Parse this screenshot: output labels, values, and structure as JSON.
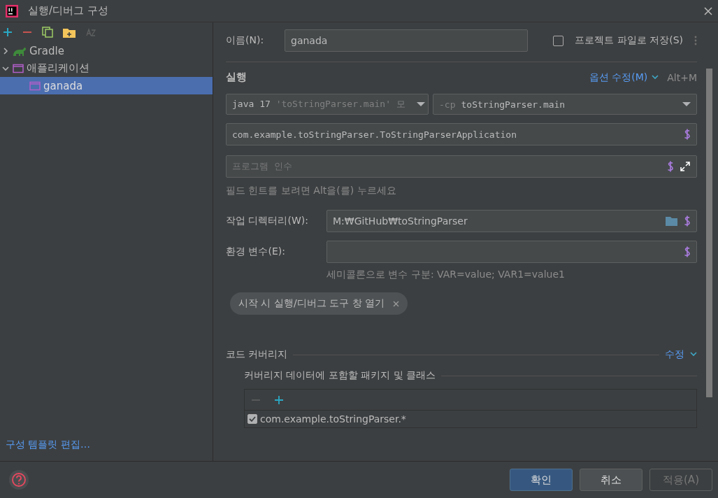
{
  "window": {
    "title": "실행/디버그 구성"
  },
  "sidebar": {
    "tree": [
      {
        "label": "Gradle",
        "kind": "gradle",
        "expanded": false,
        "selected": false
      },
      {
        "label": "애플리케이션",
        "kind": "application",
        "expanded": true,
        "selected": false,
        "children": [
          {
            "label": "ganada",
            "kind": "application",
            "selected": true
          }
        ]
      }
    ],
    "template_link": "구성 템플릿 편집…"
  },
  "form": {
    "name_label": "이름(N):",
    "name_value": "ganada",
    "store": {
      "label": "프로젝트 파일로 저장(S)",
      "checked": false
    },
    "run": {
      "title": "실행",
      "modify_link": "옵션 수정(M)",
      "shortcut": "Alt+M",
      "jdk_select": {
        "prefix": "java 17",
        "value": "'toStringParser.main' 모"
      },
      "cp_select": {
        "prefix": "-cp",
        "value": "toStringParser.main"
      },
      "main_class": "com.example.toStringParser.ToStringParserApplication",
      "args_placeholder": "프로그램 인수",
      "hint": "필드 힌트를 보려면 Alt을(를) 누르세요",
      "workdir_label": "작업 디렉터리(W):",
      "workdir_value": "M:₩GitHub₩toStringParser",
      "env_label": "환경 변수(E):",
      "env_hint": "세미콜론으로 변수 구분: VAR=value; VAR1=value1",
      "tag": "시작 시 실행/디버그 도구 창 열기"
    },
    "coverage": {
      "title": "코드 커버리지",
      "modify_link": "수정",
      "subtitle": "커버리지 데이터에 포함할 패키지 및 클래스",
      "rows": [
        {
          "label": "com.example.toStringParser.*",
          "checked": true
        }
      ]
    }
  },
  "buttons": [
    {
      "label": "확인",
      "primary": true,
      "disabled": false
    },
    {
      "label": "취소",
      "primary": false,
      "disabled": false
    },
    {
      "label": "적용(A)",
      "primary": false,
      "disabled": true
    }
  ]
}
